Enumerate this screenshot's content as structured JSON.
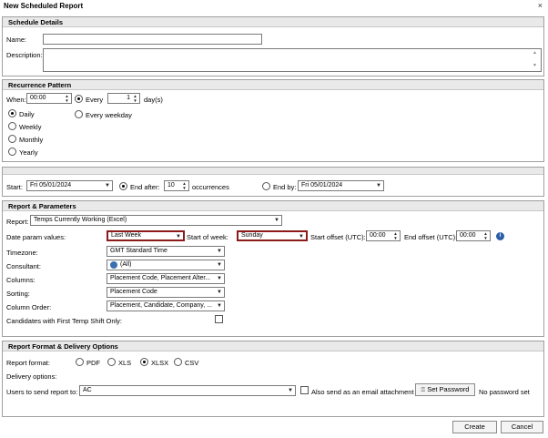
{
  "window": {
    "title": "New Scheduled Report",
    "close_glyph": "×"
  },
  "schedule": {
    "header": "Schedule Details",
    "name_label": "Name:",
    "name_value": "",
    "description_label": "Description:",
    "description_value": ""
  },
  "recurrence": {
    "header": "Recurrence Pattern",
    "when_label": "When:",
    "when_value": "00:00",
    "every_label": "Every",
    "every_value": "1",
    "days_label": "day(s)",
    "every_weekday_label": "Every weekday",
    "options": [
      "Daily",
      "Weekly",
      "Monthly",
      "Yearly"
    ],
    "selected": "Daily"
  },
  "range": {
    "start_label": "Start:",
    "start_value": "Fri 05/01/2024",
    "end_after_label": "End after:",
    "end_after_value": "10",
    "occurrences_label": "occurrences",
    "end_by_label": "End by:",
    "end_by_value": "Fri 05/01/2024"
  },
  "params": {
    "header": "Report & Parameters",
    "report_label": "Report:",
    "report_value": "Temps Currently Working (Excel)",
    "date_param_label": "Date param values:",
    "date_param_value": "Last Week",
    "start_of_week_label": "Start of week:",
    "start_of_week_value": "Sunday",
    "start_offset_label": "Start offset (UTC):",
    "start_offset_value": "00:00",
    "end_offset_label": "End offset (UTC):",
    "end_offset_value": "00:00",
    "timezone_label": "Timezone:",
    "timezone_value": "GMT Standard Time",
    "consultant_label": "Consultant:",
    "consultant_value": "(All)",
    "columns_label": "Columns:",
    "columns_value": "Placement Code, Placement Alter...",
    "sorting_label": "Sorting:",
    "sorting_value": "Placement Code",
    "column_order_label": "Column Order:",
    "column_order_value": "Placement, Candidate, Company, ...",
    "first_shift_label": "Candidates with First Temp Shift Only:"
  },
  "delivery": {
    "header": "Report Format & Delivery Options",
    "format_label": "Report format:",
    "formats": [
      "PDF",
      "XLS",
      "XLSX",
      "CSV"
    ],
    "selected_format": "XLSX",
    "delivery_options_label": "Delivery options:",
    "users_label": "Users to send report to:",
    "users_value": "AC",
    "email_attach_label": "Also send as an email attachment",
    "set_password_label": "Set Password",
    "no_password_label": "No password set"
  },
  "footer": {
    "create_label": "Create",
    "cancel_label": "Cancel"
  },
  "icons": {
    "info": "info-icon",
    "person": "person-icon",
    "key": "key-icon"
  },
  "colors": {
    "highlight_border": "#8b1a1a",
    "info_blue": "#2b5ea7"
  }
}
